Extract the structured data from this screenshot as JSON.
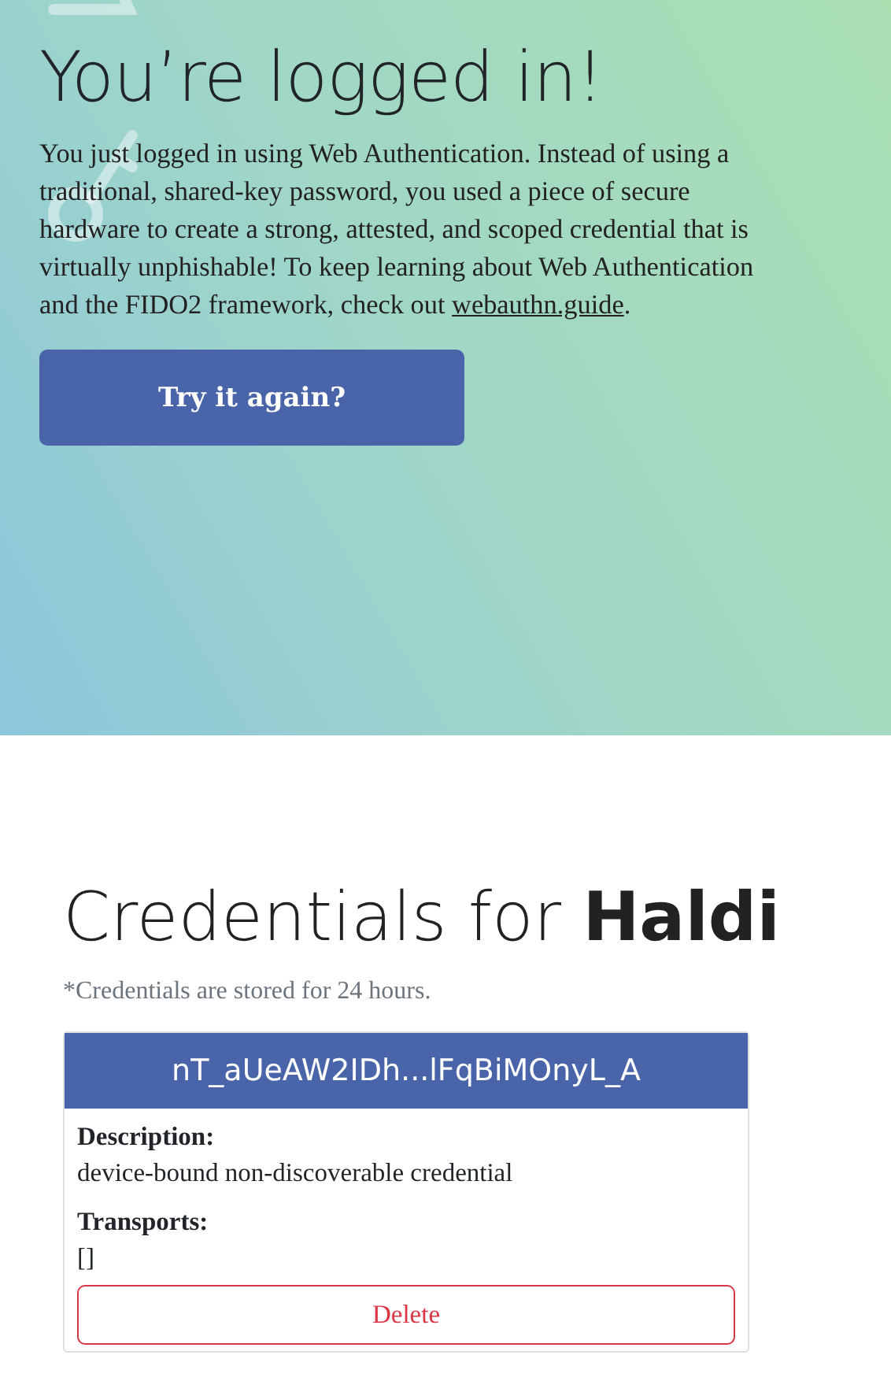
{
  "hero": {
    "title": "You’re logged in!",
    "text": "You just logged in using Web Authentication. Instead of using a traditional, shared-key password, you used a piece of secure hardware to create a strong, attested, and scoped credential that is virtually unphishable! To keep learning about Web Authentication and the FIDO2 framework, check out ",
    "link": "webauthn.guide",
    "text_end": ".",
    "button": "Try it again?"
  },
  "credentials": {
    "title": "Credentials for **Haldi**",
    "note": "*Credentials are stored for 24 hours.",
    "items": [
      {
        "id": "nT_aUeAW2IDh...lFqBiMOnyL_A",
        "fields": [
          {
            "label": "Description:",
            "value": "device-bound non-discoverable credential"
          },
          {
            "label": "Transports:",
            "value": "[]"
          }
        ],
        "button": "Delete"
      }
    ]
  }
}
